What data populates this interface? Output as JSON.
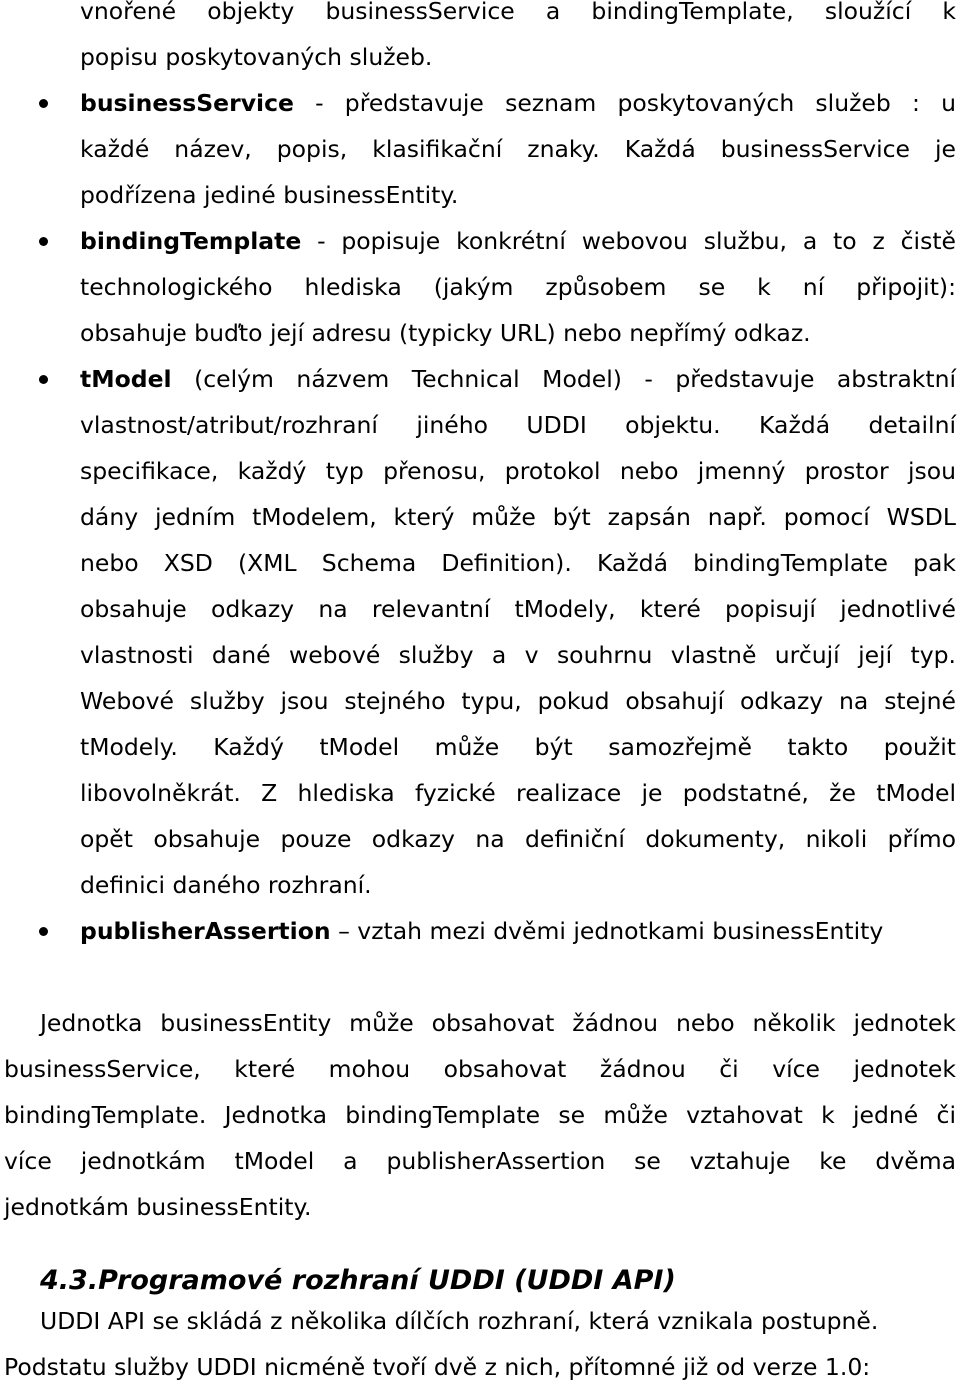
{
  "document": {
    "list_continuation": {
      "lines": [
        "vnořené objekty businessService a bindingTemplate, sloužící k",
        "popisu poskytovaných služeb."
      ]
    },
    "bullets": [
      {
        "term": "businessService",
        "first_line_rest": " - představuje seznam poskytovaných služeb : u",
        "lines": [
          "každé název, popis, klasifikační znaky. Každá businessService je",
          "podřízena jediné businessEntity."
        ]
      },
      {
        "term": "bindingTemplate",
        "first_line_rest": " - popisuje konkrétní webovou službu, a to z čistě",
        "lines": [
          "technologického hlediska (jakým způsobem se k ní připojit):",
          "obsahuje buďto její adresu (typicky URL) nebo nepřímý odkaz."
        ]
      },
      {
        "term": "tModel",
        "first_line_rest": " (celým názvem Technical Model) - představuje abstraktní",
        "lines": [
          "vlastnost/atribut/rozhraní jiného UDDI objektu. Každá detailní",
          "specifikace, každý typ přenosu, protokol nebo jmenný prostor jsou",
          "dány jedním tModelem, který může být zapsán např. pomocí WSDL",
          "nebo XSD (XML Schema Definition). Každá bindingTemplate pak",
          "obsahuje odkazy na relevantní tModely, které popisují jednotlivé",
          "vlastnosti dané webové služby a v souhrnu vlastně určují její typ.",
          "Webové služby jsou stejného typu, pokud obsahují odkazy na stejné",
          "tModely. Každý tModel může být samozřejmě takto použit",
          "libovolněkrát. Z hlediska fyzické realizace je podstatné, že tModel",
          "opět obsahuje pouze odkazy na definiční dokumenty, nikoli přímo",
          "definici daného rozhraní."
        ]
      },
      {
        "term": "publisherAssertion",
        "first_line_rest": " – vztah mezi dvěmi jednotkami businessEntity",
        "lines": []
      }
    ],
    "paragraph": {
      "lines": [
        "Jednotka businessEntity může obsahovat žádnou nebo několik jednotek",
        "businessService, které mohou obsahovat žádnou či více jednotek",
        "bindingTemplate. Jednotka bindingTemplate se může vztahovat k jedné či",
        "více jednotkám tModel a publisherAssertion se vztahuje ke dvěma",
        "jednotkám businessEntity."
      ]
    },
    "section": {
      "heading": "4.3.Programové rozhraní UDDI (UDDI API)",
      "lines": [
        "UDDI API se skládá z několika dílčích rozhraní, která vznikala postupně.",
        "Podstatu služby UDDI nicméně tvoří dvě z nich, přítomné již od verze 1.0:"
      ]
    }
  }
}
